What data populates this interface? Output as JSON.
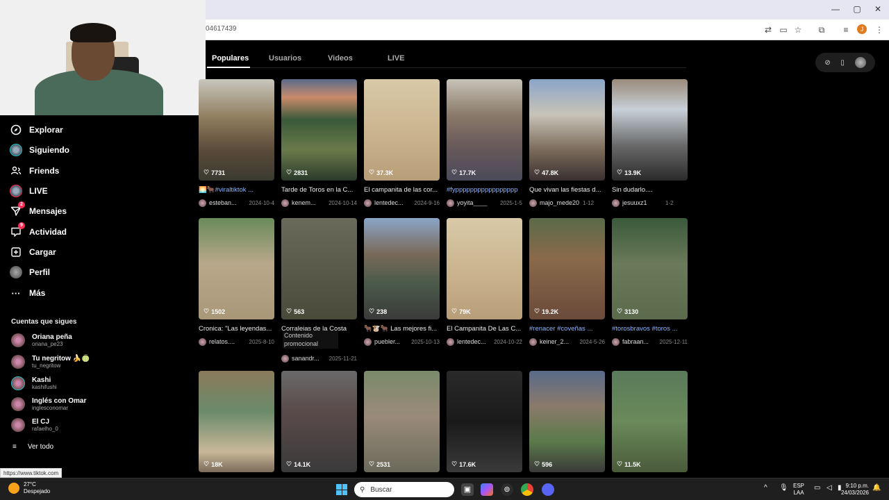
{
  "browser": {
    "url": "04617439",
    "window_controls": [
      "—",
      "▢",
      "✕"
    ],
    "profile_initial": "J"
  },
  "tabs": [
    {
      "label": "Populares",
      "active": true
    },
    {
      "label": "Usuarios",
      "active": false
    },
    {
      "label": "Videos",
      "active": false
    },
    {
      "label": "LIVE",
      "active": false
    }
  ],
  "sidebar": {
    "nav": [
      {
        "label": "Explorar",
        "icon": "compass-icon"
      },
      {
        "label": "Siguiendo",
        "icon": "avatar-icon"
      },
      {
        "label": "Friends",
        "icon": "friends-icon"
      },
      {
        "label": "LIVE",
        "icon": "live-avatar-icon"
      },
      {
        "label": "Mensajes",
        "icon": "send-icon",
        "badge": "2"
      },
      {
        "label": "Actividad",
        "icon": "activity-icon",
        "badge": "9"
      },
      {
        "label": "Cargar",
        "icon": "plus-icon"
      },
      {
        "label": "Perfil",
        "icon": "profile-avatar-icon"
      },
      {
        "label": "Más",
        "icon": "more-icon"
      }
    ],
    "following_title": "Cuentas que sigues",
    "following": [
      {
        "name": "Oriana peña",
        "handle": "oriana_pe23"
      },
      {
        "name": "Tu negritow 🍌🍈",
        "handle": "tu_negritow"
      },
      {
        "name": "Kashi",
        "handle": "kashifushi"
      },
      {
        "name": "Inglés con Omar",
        "handle": "inglesconomar"
      },
      {
        "name": "El CJ",
        "handle": "rafaelho_0"
      }
    ],
    "see_all": "Ver todo"
  },
  "status_url": "https://www.tiktok.com",
  "videos": [
    {
      "views": "7731",
      "caption": "🌅🐂#viraltiktok ...",
      "tag": true,
      "user": "esteban...",
      "date": "2024-10-4",
      "bg": "linear-gradient(180deg,#c9c6bd 0%,#8c7a5a 40%,#5a4a3a 70%,#3a3a2f 100%)"
    },
    {
      "views": "2831",
      "caption": "Tarde de Toros en la C...",
      "tag": false,
      "user": "kenem...",
      "date": "2024-10-14",
      "bg": "linear-gradient(180deg,#5a6a8a 0%,#c98a6a 18%,#3a5a3a 40%,#6a7a4a 70%,#2a3a2a 100%)"
    },
    {
      "views": "37.3K",
      "caption": "El campanita de las cor...",
      "tag": false,
      "user": "lentedec...",
      "date": "2024-9-16",
      "bg": "linear-gradient(180deg,#d8c9a8 0%,#cbb58f 50%,#b89e78 100%)"
    },
    {
      "views": "17.7K",
      "caption": "#fyppppppppppppppppp",
      "tag": true,
      "user": "yoyita____",
      "date": "2025-1-5",
      "bg": "linear-gradient(180deg,#c8c3b8 0%,#8a7a6a 35%,#6a5a5a 65%,#4a4a5a 100%)"
    },
    {
      "views": "47.8K",
      "caption": "Que vivan las fiestas d...",
      "tag": false,
      "user": "majo_mede20",
      "date": "1-12",
      "bg": "linear-gradient(180deg,#8aa5c8 0%,#c8c3b8 35%,#7a6a5a 70%,#3a3030 100%)"
    },
    {
      "views": "13.9K",
      "caption": "Sin dudarlo....",
      "tag": false,
      "user": "jesuuxz1",
      "date": "1-2",
      "bg": "linear-gradient(180deg,#9a8a7a 0%,#c8d0d8 30%,#6a6a6a 65%,#2a2a2a 100%)"
    },
    {
      "views": "1502",
      "caption": "Cronica: \"Las leyendas...",
      "tag": false,
      "user": "relatos....",
      "date": "2025-8-10",
      "bg": "linear-gradient(180deg,#6a8a5a 0%,#b8a88a 45%,#a89878 100%)"
    },
    {
      "views": "563",
      "caption": "Corralejas de la Costa",
      "tag": false,
      "user": "sanandr...",
      "date": "2025-11-21",
      "promo": "Contenido promocional",
      "bg": "linear-gradient(180deg,#6a6a5a 0%,#5a5a4a 50%,#4a4a3a 100%)"
    },
    {
      "views": "238",
      "caption": "🐂🐮🐂 Las mejores fi...",
      "tag": false,
      "user": "puebler...",
      "date": "2025-10-13",
      "bg": "linear-gradient(180deg,#8aa5c8 0%,#7a6a5a 35%,#4a5a4a 65%,#3a3a3a 100%)"
    },
    {
      "views": "79K",
      "caption": "El Campanita De Las C...",
      "tag": false,
      "user": "lentedec...",
      "date": "2024-10-22",
      "bg": "linear-gradient(180deg,#d8c9a8 0%,#cbb58f 50%,#b89e78 100%)"
    },
    {
      "views": "19.2K",
      "caption": "#renacer #coveñas ...",
      "tag": true,
      "user": "keiner_2...",
      "date": "2024-5-26",
      "bg": "linear-gradient(180deg,#5a6a4a 0%,#8a6a4a 40%,#6a4a3a 100%)"
    },
    {
      "views": "3130",
      "caption": "#torosbravos #toros ...",
      "tag": true,
      "user": "fabraan...",
      "date": "2025-12-11",
      "bg": "linear-gradient(180deg,#3a5a3a 0%,#6a7a5a 45%,#5a6a4a 100%)"
    },
    {
      "views": "18K",
      "caption": "",
      "tag": false,
      "user": "",
      "date": "",
      "bg": "linear-gradient(180deg,#8a7a5a 0%,#6a8a6a 40%,#c8b898 80%,#7a6a5a 100%)"
    },
    {
      "views": "14.1K",
      "caption": "",
      "tag": false,
      "user": "",
      "date": "",
      "bg": "linear-gradient(180deg,#6a6a6a 0%,#5a4a4a 40%,#3a3a3a 100%)"
    },
    {
      "views": "2531",
      "caption": "",
      "tag": false,
      "user": "",
      "date": "",
      "bg": "linear-gradient(180deg,#7a8a6a 0%,#9a8a7a 45%,#6a6a5a 100%)"
    },
    {
      "views": "17.6K",
      "caption": "",
      "tag": false,
      "user": "",
      "date": "",
      "bg": "linear-gradient(180deg,#2a2a2a 0%,#1a1a1a 50%,#3a3a3a 100%)"
    },
    {
      "views": "596",
      "caption": "",
      "tag": false,
      "user": "",
      "date": "",
      "bg": "linear-gradient(180deg,#5a6a8a 0%,#8a7a6a 35%,#5a7a4a 70%,#3a3a3a 100%)"
    },
    {
      "views": "11.5K",
      "caption": "",
      "tag": false,
      "user": "",
      "date": "",
      "bg": "linear-gradient(180deg,#5a7a5a 0%,#6a8a5a 50%,#4a5a3a 100%)"
    }
  ],
  "taskbar": {
    "temp": "27°C",
    "weather": "Despejado",
    "search": "Buscar",
    "lang": "ESP",
    "lang2": "LAA",
    "time": "9:10 p.m.",
    "date": "24/03/2026"
  }
}
